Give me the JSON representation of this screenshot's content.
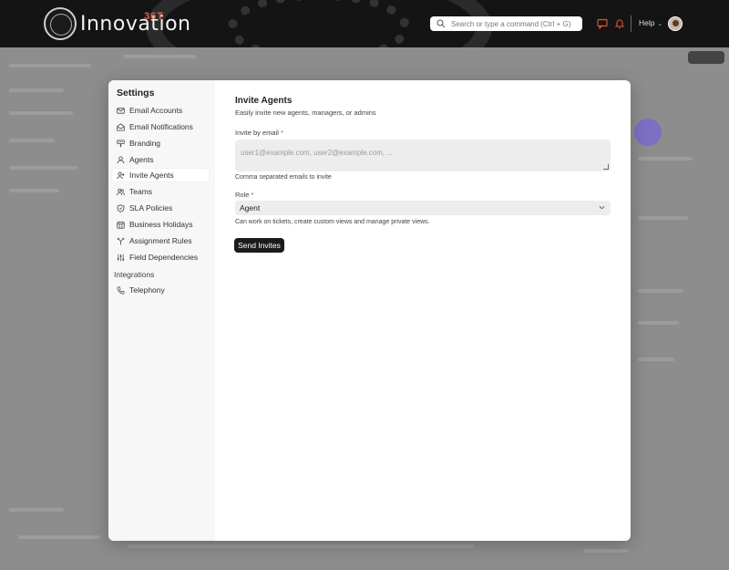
{
  "header": {
    "logo_text": "Innovation",
    "logo_sup": "36T",
    "search_placeholder": "Search or type a command (Ctrl + G)",
    "help_label": "Help",
    "icons": [
      "chat-icon",
      "bell-icon",
      "chevron-down-icon"
    ]
  },
  "settings": {
    "title": "Settings",
    "items": [
      {
        "label": "Email Accounts",
        "icon": "mail-icon"
      },
      {
        "label": "Email Notifications",
        "icon": "mail-open-icon"
      },
      {
        "label": "Branding",
        "icon": "brush-icon"
      },
      {
        "label": "Agents",
        "icon": "user-icon"
      },
      {
        "label": "Invite Agents",
        "icon": "user-plus-icon",
        "active": true
      },
      {
        "label": "Teams",
        "icon": "users-icon"
      },
      {
        "label": "SLA Policies",
        "icon": "shield-icon"
      },
      {
        "label": "Business Holidays",
        "icon": "calendar-icon"
      },
      {
        "label": "Assignment Rules",
        "icon": "split-icon"
      },
      {
        "label": "Field Dependencies",
        "icon": "sliders-icon"
      }
    ],
    "section_integrations": "Integrations",
    "integrations": [
      {
        "label": "Telephony",
        "icon": "phone-icon"
      }
    ]
  },
  "invite": {
    "title": "Invite Agents",
    "subtitle": "Easily invite new agents, managers, or admins",
    "email_label": "Invite by email",
    "required_mark": "*",
    "email_placeholder": "user1@example.com, user2@example.com, ...",
    "email_help": "Comma separated emails to invite",
    "role_label": "Role",
    "role_value": "Agent",
    "role_help": "Can work on tickets, create custom views and manage private views.",
    "send_label": "Send Invites"
  },
  "colors": {
    "topbar": "#141414",
    "accent_logo": "#e0614a",
    "button": "#1b1b1b",
    "notification": "#e2552e"
  }
}
